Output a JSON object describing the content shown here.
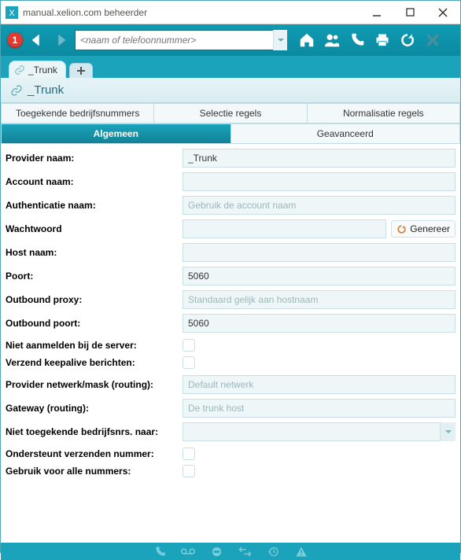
{
  "window": {
    "title": "manual.xelion.com beheerder"
  },
  "toolbar": {
    "badge": "1",
    "search_placeholder": "<naam of telefoonnummer>"
  },
  "tab": {
    "label": "_Trunk"
  },
  "page": {
    "title": "_Trunk"
  },
  "subtabs": {
    "row1": [
      "Toegekende bedrijfsnummers",
      "Selectie regels",
      "Normalisatie regels"
    ],
    "row2": [
      "Algemeen",
      "Geavanceerd"
    ]
  },
  "form": {
    "provider_naam": {
      "label": "Provider naam:",
      "value": "_Trunk"
    },
    "account_naam": {
      "label": "Account naam:",
      "value": ""
    },
    "authenticatie_naam": {
      "label": "Authenticatie naam:",
      "placeholder": "Gebruik de account naam",
      "value": ""
    },
    "wachtwoord": {
      "label": "Wachtwoord",
      "value": "",
      "generate_label": "Genereer"
    },
    "host_naam": {
      "label": "Host naam:",
      "value": ""
    },
    "poort": {
      "label": "Poort:",
      "value": "5060"
    },
    "outbound_proxy": {
      "label": "Outbound proxy:",
      "placeholder": "Standaard gelijk aan hostnaam",
      "value": ""
    },
    "outbound_poort": {
      "label": "Outbound poort:",
      "value": "5060"
    },
    "niet_aanmelden": {
      "label": "Niet aanmelden bij de server:",
      "checked": false
    },
    "verzend_keepalive": {
      "label": "Verzend keepalive berichten:",
      "checked": false
    },
    "provider_netwerk": {
      "label": "Provider netwerk/mask (routing):",
      "placeholder": "Default netwerk",
      "value": ""
    },
    "gateway_routing": {
      "label": "Gateway (routing):",
      "placeholder": "De trunk host",
      "value": ""
    },
    "niet_toegekende": {
      "label": "Niet toegekende bedrijfsnrs. naar:",
      "value": ""
    },
    "ondersteunt_verzenden": {
      "label": "Ondersteunt verzenden nummer:",
      "checked": false
    },
    "gebruik_alle": {
      "label": "Gebruik voor alle nummers:",
      "checked": false
    }
  }
}
